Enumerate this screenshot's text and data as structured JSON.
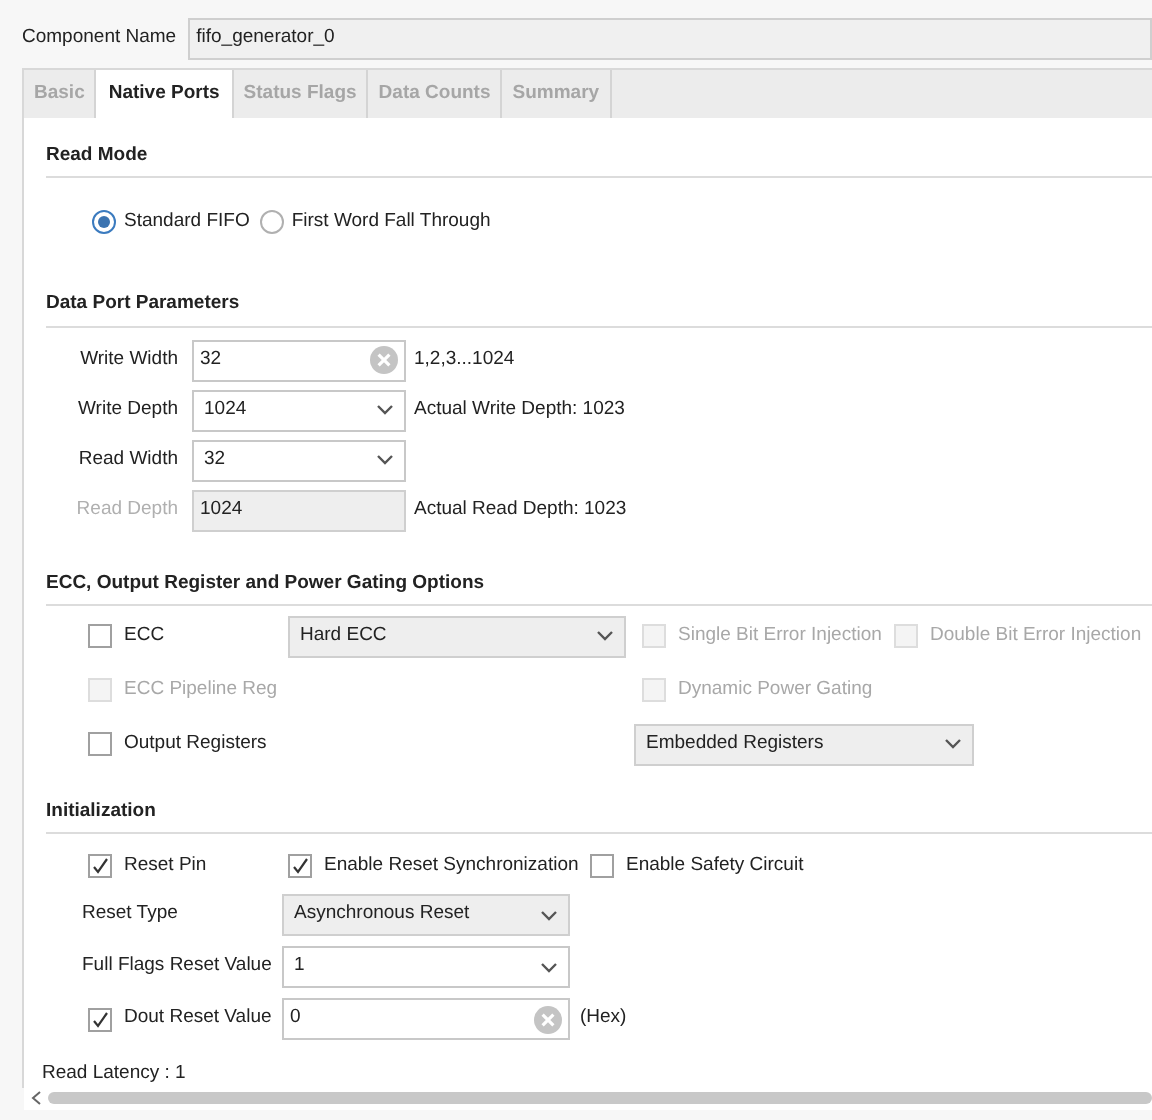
{
  "component_name": {
    "label": "Component Name",
    "value": "fifo_generator_0"
  },
  "tabs": [
    {
      "label": "Basic",
      "selected": false
    },
    {
      "label": "Native Ports",
      "selected": true
    },
    {
      "label": "Status Flags",
      "selected": false
    },
    {
      "label": "Data Counts",
      "selected": false
    },
    {
      "label": "Summary",
      "selected": false
    }
  ],
  "read_mode": {
    "title": "Read Mode",
    "options": [
      {
        "label": "Standard FIFO",
        "selected": true
      },
      {
        "label": "First Word Fall Through",
        "selected": false
      }
    ]
  },
  "data_port": {
    "title": "Data Port Parameters",
    "rows": [
      {
        "label": "Write Width",
        "kind": "text",
        "value": "32",
        "note": "1,2,3...1024",
        "disabled": false
      },
      {
        "label": "Write Depth",
        "kind": "select",
        "value": "1024",
        "note": "Actual Write Depth: 1023",
        "disabled": false
      },
      {
        "label": "Read Width",
        "kind": "select",
        "value": "32",
        "disabled": false
      },
      {
        "label": "Read Depth",
        "kind": "text",
        "value": "1024",
        "note": "Actual Read Depth: 1023",
        "disabled": true
      }
    ]
  },
  "ecc_options": {
    "title": "ECC, Output Register and Power Gating Options",
    "ecc": {
      "label": "ECC",
      "checked": false,
      "disabled": false
    },
    "ecc_type": {
      "value": "Hard ECC",
      "disabled": true
    },
    "single_bit_error_injection": {
      "label": "Single Bit Error Injection",
      "checked": false,
      "disabled": true
    },
    "double_bit_error_injection": {
      "label": "Double Bit Error Injection",
      "checked": false,
      "disabled": true
    },
    "ecc_pipeline_reg": {
      "label": "ECC Pipeline Reg",
      "checked": false,
      "disabled": true
    },
    "dynamic_power_gating": {
      "label": "Dynamic Power Gating",
      "checked": false,
      "disabled": true
    },
    "output_registers": {
      "label": "Output Registers",
      "checked": false,
      "disabled": false
    },
    "output_register_type": {
      "value": "Embedded Registers",
      "disabled": true
    }
  },
  "initialization": {
    "title": "Initialization",
    "reset_pin": {
      "label": "Reset Pin",
      "checked": true,
      "disabled": false
    },
    "enable_reset_synchronization": {
      "label": "Enable Reset Synchronization",
      "checked": true,
      "disabled": false
    },
    "enable_safety_circuit": {
      "label": "Enable Safety Circuit",
      "checked": false,
      "disabled": false
    },
    "reset_type": {
      "label": "Reset Type",
      "value": "Asynchronous Reset",
      "disabled": true
    },
    "full_flags_reset_value": {
      "label": "Full Flags Reset Value",
      "value": "1",
      "disabled": false
    },
    "dout_reset_value": {
      "label": "Dout Reset Value",
      "checked": true,
      "disabled": false,
      "value": "0",
      "suffix": "(Hex)"
    }
  },
  "read_latency": "Read Latency : 1"
}
